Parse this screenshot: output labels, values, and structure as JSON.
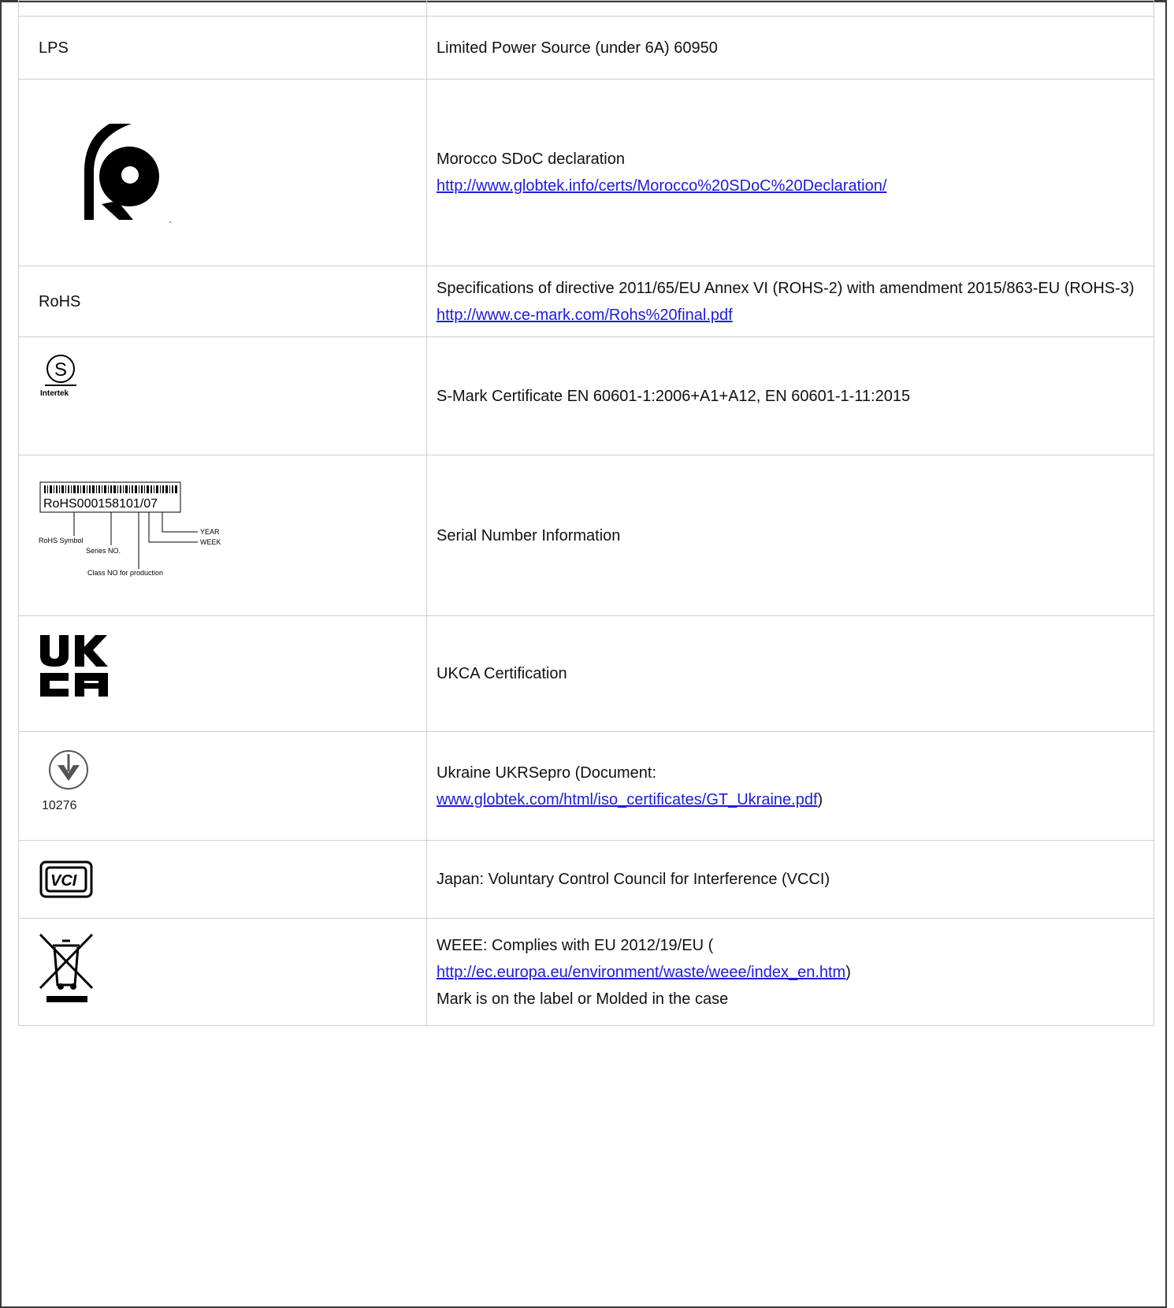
{
  "rows": [
    {
      "mark": "",
      "desc": ""
    },
    {
      "mark": "LPS",
      "desc": "Limited Power Source (under 6A) 60950"
    },
    {
      "mark_icon": "morocco-cmim-mark-icon",
      "desc": "Morocco SDoC declaration",
      "link": "http://www.globtek.info/certs/Morocco%20SDoC%20Declaration/"
    },
    {
      "mark": "RoHS",
      "desc": "Specifications of directive 2011/65/EU Annex VI (ROHS-2) with amendment 2015/863-EU (ROHS-3)",
      "link": "http://www.ce-mark.com/Rohs%20final.pdf"
    },
    {
      "mark_icon": "intertek-s-mark-icon",
      "icon_text": "Intertek",
      "desc": "S-Mark Certificate EN 60601-1:2006+A1+A12, EN 60601-1-11:2015"
    },
    {
      "mark_icon": "serial-number-diagram-icon",
      "serial_code": "RoHS000158101/07",
      "serial_labels": {
        "rohs": "RoHS Symbol",
        "series": "Series NO.",
        "class": "Class NO for production",
        "year": "YEAR",
        "week": "WEEK"
      },
      "desc": "Serial Number Information"
    },
    {
      "mark_icon": "ukca-mark-icon",
      "desc": "UKCA Certification"
    },
    {
      "mark_icon": "ukrsepro-mark-icon",
      "icon_text": "10276",
      "desc": "Ukraine UKRSepro (Document:",
      "link": "www.globtek.com/html/iso_certificates/GT_Ukraine.pdf",
      "after_link": ")"
    },
    {
      "mark_icon": "vcci-mark-icon",
      "desc": "Japan: Voluntary Control Council for Interference (VCCI)"
    },
    {
      "mark_icon": "weee-bin-icon",
      "desc": "WEEE: Complies with EU 2012/19/EU (",
      "link": "http://ec.europa.eu/environment/waste/weee/index_en.htm",
      "after_link": ")",
      "desc2": "Mark is on the label or Molded in the case"
    }
  ]
}
